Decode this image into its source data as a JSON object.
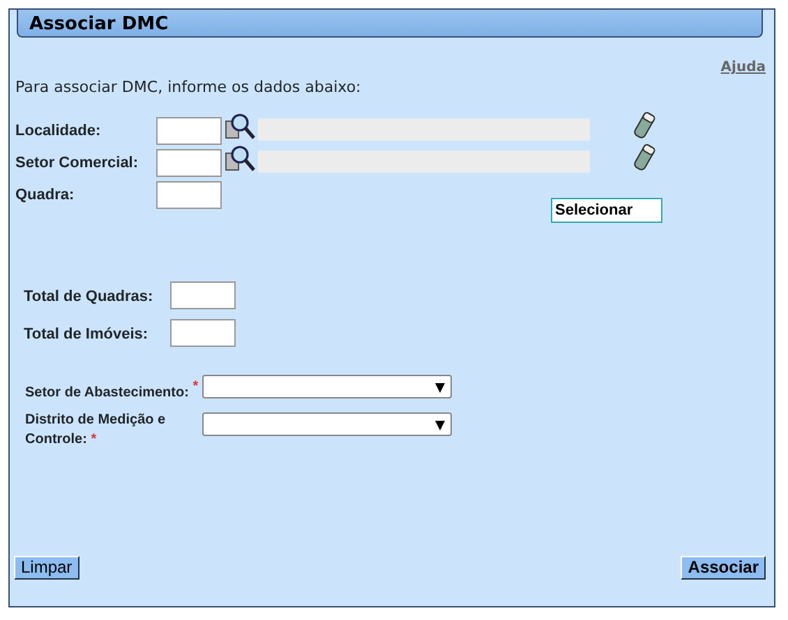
{
  "title": "Associar DMC",
  "help_link": "Ajuda",
  "intro": "Para associar DMC, informe os dados abaixo:",
  "lookup_fields": [
    {
      "label": "Localidade:"
    },
    {
      "label": "Setor Comercial:"
    }
  ],
  "quadra": {
    "label": "Quadra:"
  },
  "select_button": "Selecionar",
  "totals": [
    {
      "label": "Total de Quadras:"
    },
    {
      "label": "Total de Imóveis:"
    }
  ],
  "dropdowns": [
    {
      "label": "Setor de Abastecimento:",
      "required_mark": "*"
    },
    {
      "label": "Distrito de Medição e Controle:",
      "required_mark": "*"
    }
  ],
  "buttons": [
    {
      "label": "Limpar"
    },
    {
      "label": "Associar"
    }
  ]
}
